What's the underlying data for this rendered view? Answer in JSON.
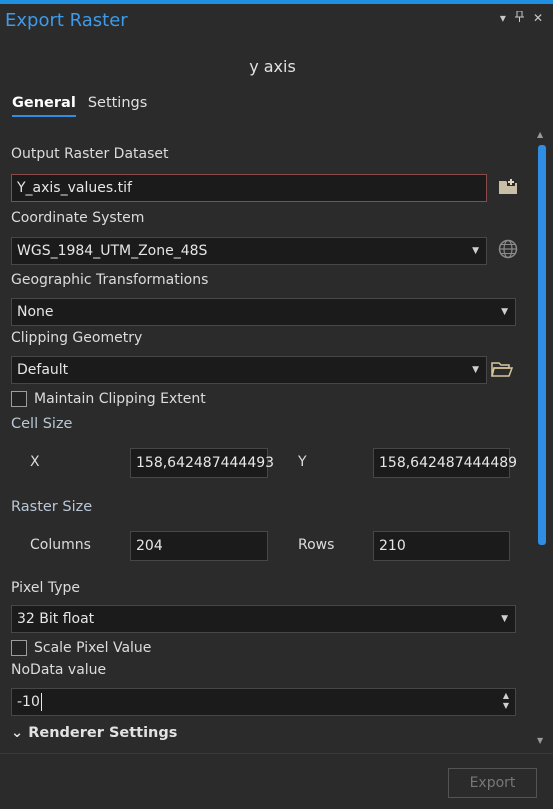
{
  "pane": {
    "title": "Export Raster",
    "icons": [
      "chevron-down-icon",
      "pin-icon",
      "close-icon"
    ],
    "subtitle": "y axis"
  },
  "tabs": [
    {
      "label": "General",
      "active": true
    },
    {
      "label": "Settings",
      "active": false
    }
  ],
  "output": {
    "label": "Output Raster Dataset",
    "value": "Y_axis_values.tif"
  },
  "coordinate_system": {
    "label": "Coordinate System",
    "value": "WGS_1984_UTM_Zone_48S"
  },
  "geo_transform": {
    "label": "Geographic Transformations",
    "value": "None"
  },
  "clipping": {
    "label": "Clipping Geometry",
    "value": "Default",
    "maintain_extent_label": "Maintain Clipping Extent"
  },
  "cell_size": {
    "section": "Cell Size",
    "x_label": "X",
    "x_value": "158,642487444493",
    "y_label": "Y",
    "y_value": "158,642487444489"
  },
  "raster_size": {
    "section": "Raster Size",
    "columns_label": "Columns",
    "columns_value": "204",
    "rows_label": "Rows",
    "rows_value": "210"
  },
  "pixel_type": {
    "label": "Pixel Type",
    "value": "32 Bit float",
    "scale_label": "Scale Pixel Value"
  },
  "nodata": {
    "label": "NoData value",
    "value": "-10"
  },
  "renderer": {
    "label": "Renderer Settings"
  },
  "export_button": {
    "label": "Export"
  },
  "colors": {
    "accent": "#2f8de4",
    "title": "#3d9be9",
    "background": "#2b2b2b"
  }
}
